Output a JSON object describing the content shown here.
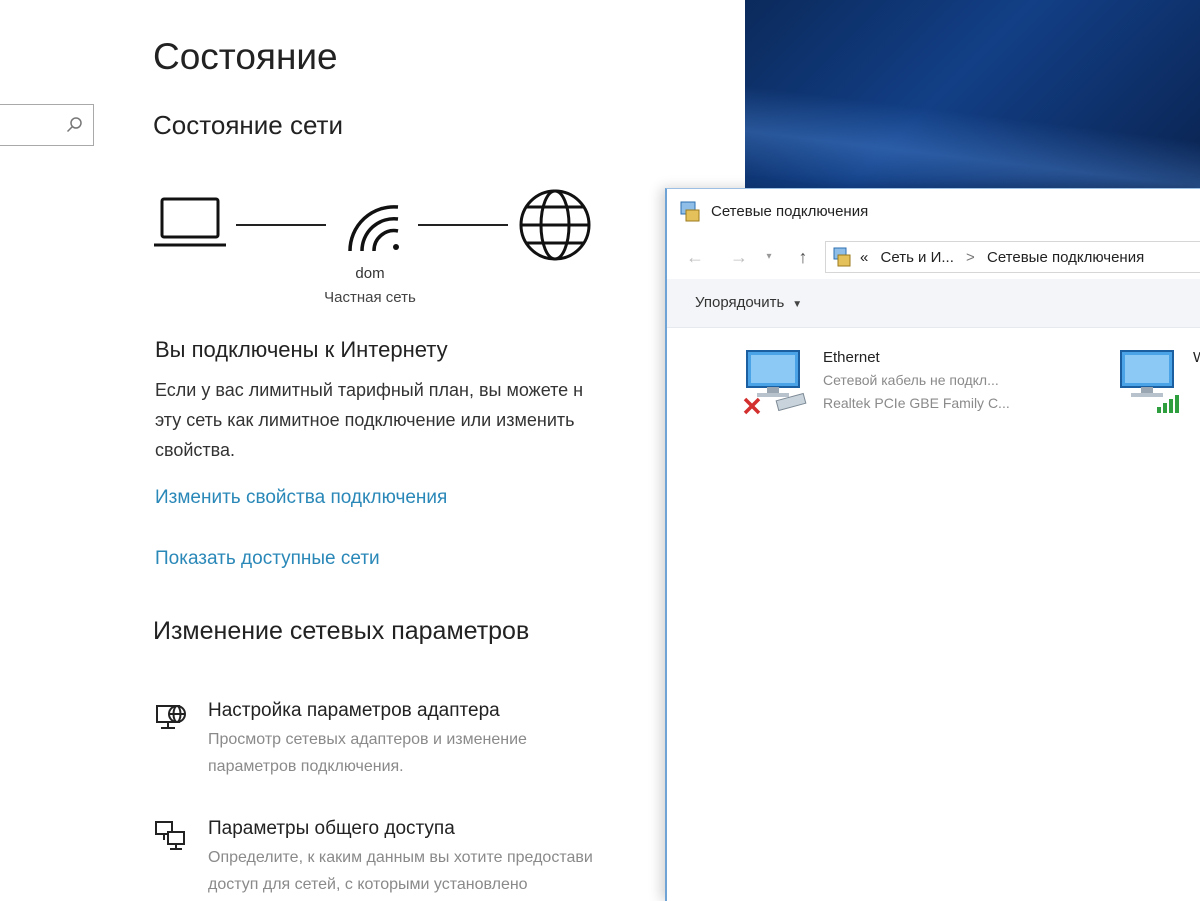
{
  "settings": {
    "search": {
      "value": "",
      "placeholder": ""
    },
    "page_title": "Состояние",
    "section_title": "Состояние сети",
    "network": {
      "name": "dom",
      "type": "Частная сеть",
      "icons": [
        "laptop-icon",
        "wifi-icon",
        "globe-icon"
      ]
    },
    "connected_title": "Вы подключены к Интернету",
    "connected_desc_lines": [
      "Если у вас лимитный тарифный план, вы можете н",
      "эту сеть как лимитное подключение или изменить",
      "свойства."
    ],
    "links": {
      "change_properties": "Изменить свойства подключения",
      "show_networks": "Показать доступные сети"
    },
    "change_section_title": "Изменение сетевых параметров",
    "options": [
      {
        "icon": "adapter-settings-icon",
        "title": "Настройка параметров адаптера",
        "desc_lines": [
          "Просмотр сетевых адаптеров и изменение",
          "параметров подключения."
        ]
      },
      {
        "icon": "sharing-options-icon",
        "title": "Параметры общего доступа",
        "desc_lines": [
          "Определите, к каким данным вы хотите предостави",
          "доступ для сетей, с которыми установлено"
        ]
      }
    ]
  },
  "explorer": {
    "title": "Сетевые подключения",
    "address": {
      "parts": [
        "«",
        "Сеть и И...",
        ">",
        "Сетевые подключения"
      ]
    },
    "toolbar": {
      "organize": "Упорядочить"
    },
    "adapters": [
      {
        "name": "Ethernet",
        "status": "Сетевой кабель не подкл...",
        "device": "Realtek PCIe GBE Family C...",
        "icon": "ethernet-adapter-icon",
        "state_color": "#d32f2f"
      },
      {
        "name": "W",
        "status": "",
        "device": "",
        "icon": "wireless-adapter-icon",
        "state_color": "#2e9e3e"
      }
    ]
  },
  "colors": {
    "link": "#2a88b8",
    "desktop": "#123f86",
    "explorer_border": "#6fa3d6"
  }
}
